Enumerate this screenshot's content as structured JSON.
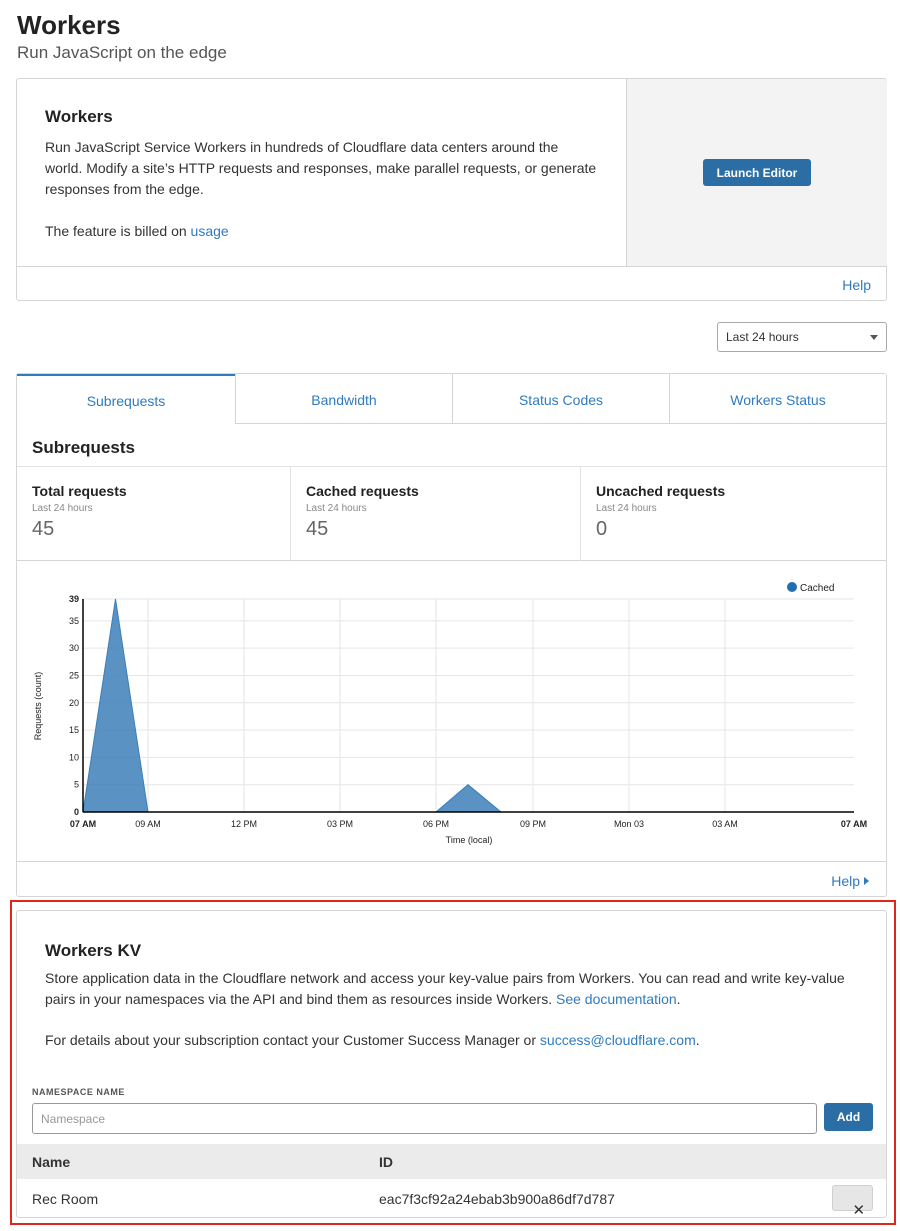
{
  "page": {
    "title": "Workers",
    "subtitle": "Run JavaScript on the edge"
  },
  "workers_card": {
    "heading": "Workers",
    "description": "Run JavaScript Service Workers in hundreds of Cloudflare data centers around the world. Modify a site’s HTTP requests and responses, make parallel requests, or generate responses from the edge.",
    "billing_prefix": "The feature is billed on ",
    "billing_link": "usage",
    "launch_button": "Launch Editor",
    "help_link": "Help"
  },
  "time_range": {
    "selected": "Last 24 hours"
  },
  "analytics": {
    "tabs": [
      {
        "label": "Subrequests",
        "active": true
      },
      {
        "label": "Bandwidth",
        "active": false
      },
      {
        "label": "Status Codes",
        "active": false
      },
      {
        "label": "Workers Status",
        "active": false
      }
    ],
    "heading": "Subrequests",
    "stats": [
      {
        "label": "Total requests",
        "period": "Last 24 hours",
        "value": "45"
      },
      {
        "label": "Cached requests",
        "period": "Last 24 hours",
        "value": "45"
      },
      {
        "label": "Uncached requests",
        "period": "Last 24 hours",
        "value": "0"
      }
    ],
    "help_link": "Help"
  },
  "chart_data": {
    "type": "area",
    "title": "",
    "xlabel": "Time (local)",
    "ylabel": "Requests (count)",
    "ylim": [
      0,
      39
    ],
    "y_ticks": [
      "0",
      "5",
      "10",
      "15",
      "20",
      "25",
      "30",
      "35",
      "39"
    ],
    "x_ticks": [
      "07 AM",
      "09 AM",
      "12 PM",
      "03 PM",
      "06 PM",
      "09 PM",
      "Mon 03",
      "03 AM",
      "07 AM"
    ],
    "legend": "top-right",
    "grid": true,
    "series": [
      {
        "name": "Cached",
        "color": "#3c7fb8",
        "points": [
          {
            "t": "07 AM",
            "v": 0
          },
          {
            "t": "08 AM",
            "v": 39
          },
          {
            "t": "09 AM",
            "v": 0
          },
          {
            "t": "06 PM",
            "v": 0
          },
          {
            "t": "07 PM",
            "v": 5
          },
          {
            "t": "08 PM",
            "v": 0
          }
        ]
      }
    ]
  },
  "kv": {
    "heading": "Workers KV",
    "description": "Store application data in the Cloudflare network and access your key-value pairs from Workers. You can read and write key-value pairs in your namespaces via the API and bind them as resources inside Workers. ",
    "doc_link": "See documentation",
    "doc_suffix": ".",
    "contact_prefix": "For details about your subscription contact your Customer Success Manager or ",
    "contact_link": "success@cloudflare.com",
    "contact_suffix": ".",
    "namespace_label": "NAMESPACE NAME",
    "namespace_placeholder": "Namespace",
    "namespace_value": "",
    "add_button": "Add",
    "columns": [
      "Name",
      "ID"
    ],
    "rows": [
      {
        "name": "Rec Room",
        "id": "eac7f3cf92a24ebab3b900a86df7d787",
        "delete_icon": "close-icon"
      }
    ]
  }
}
